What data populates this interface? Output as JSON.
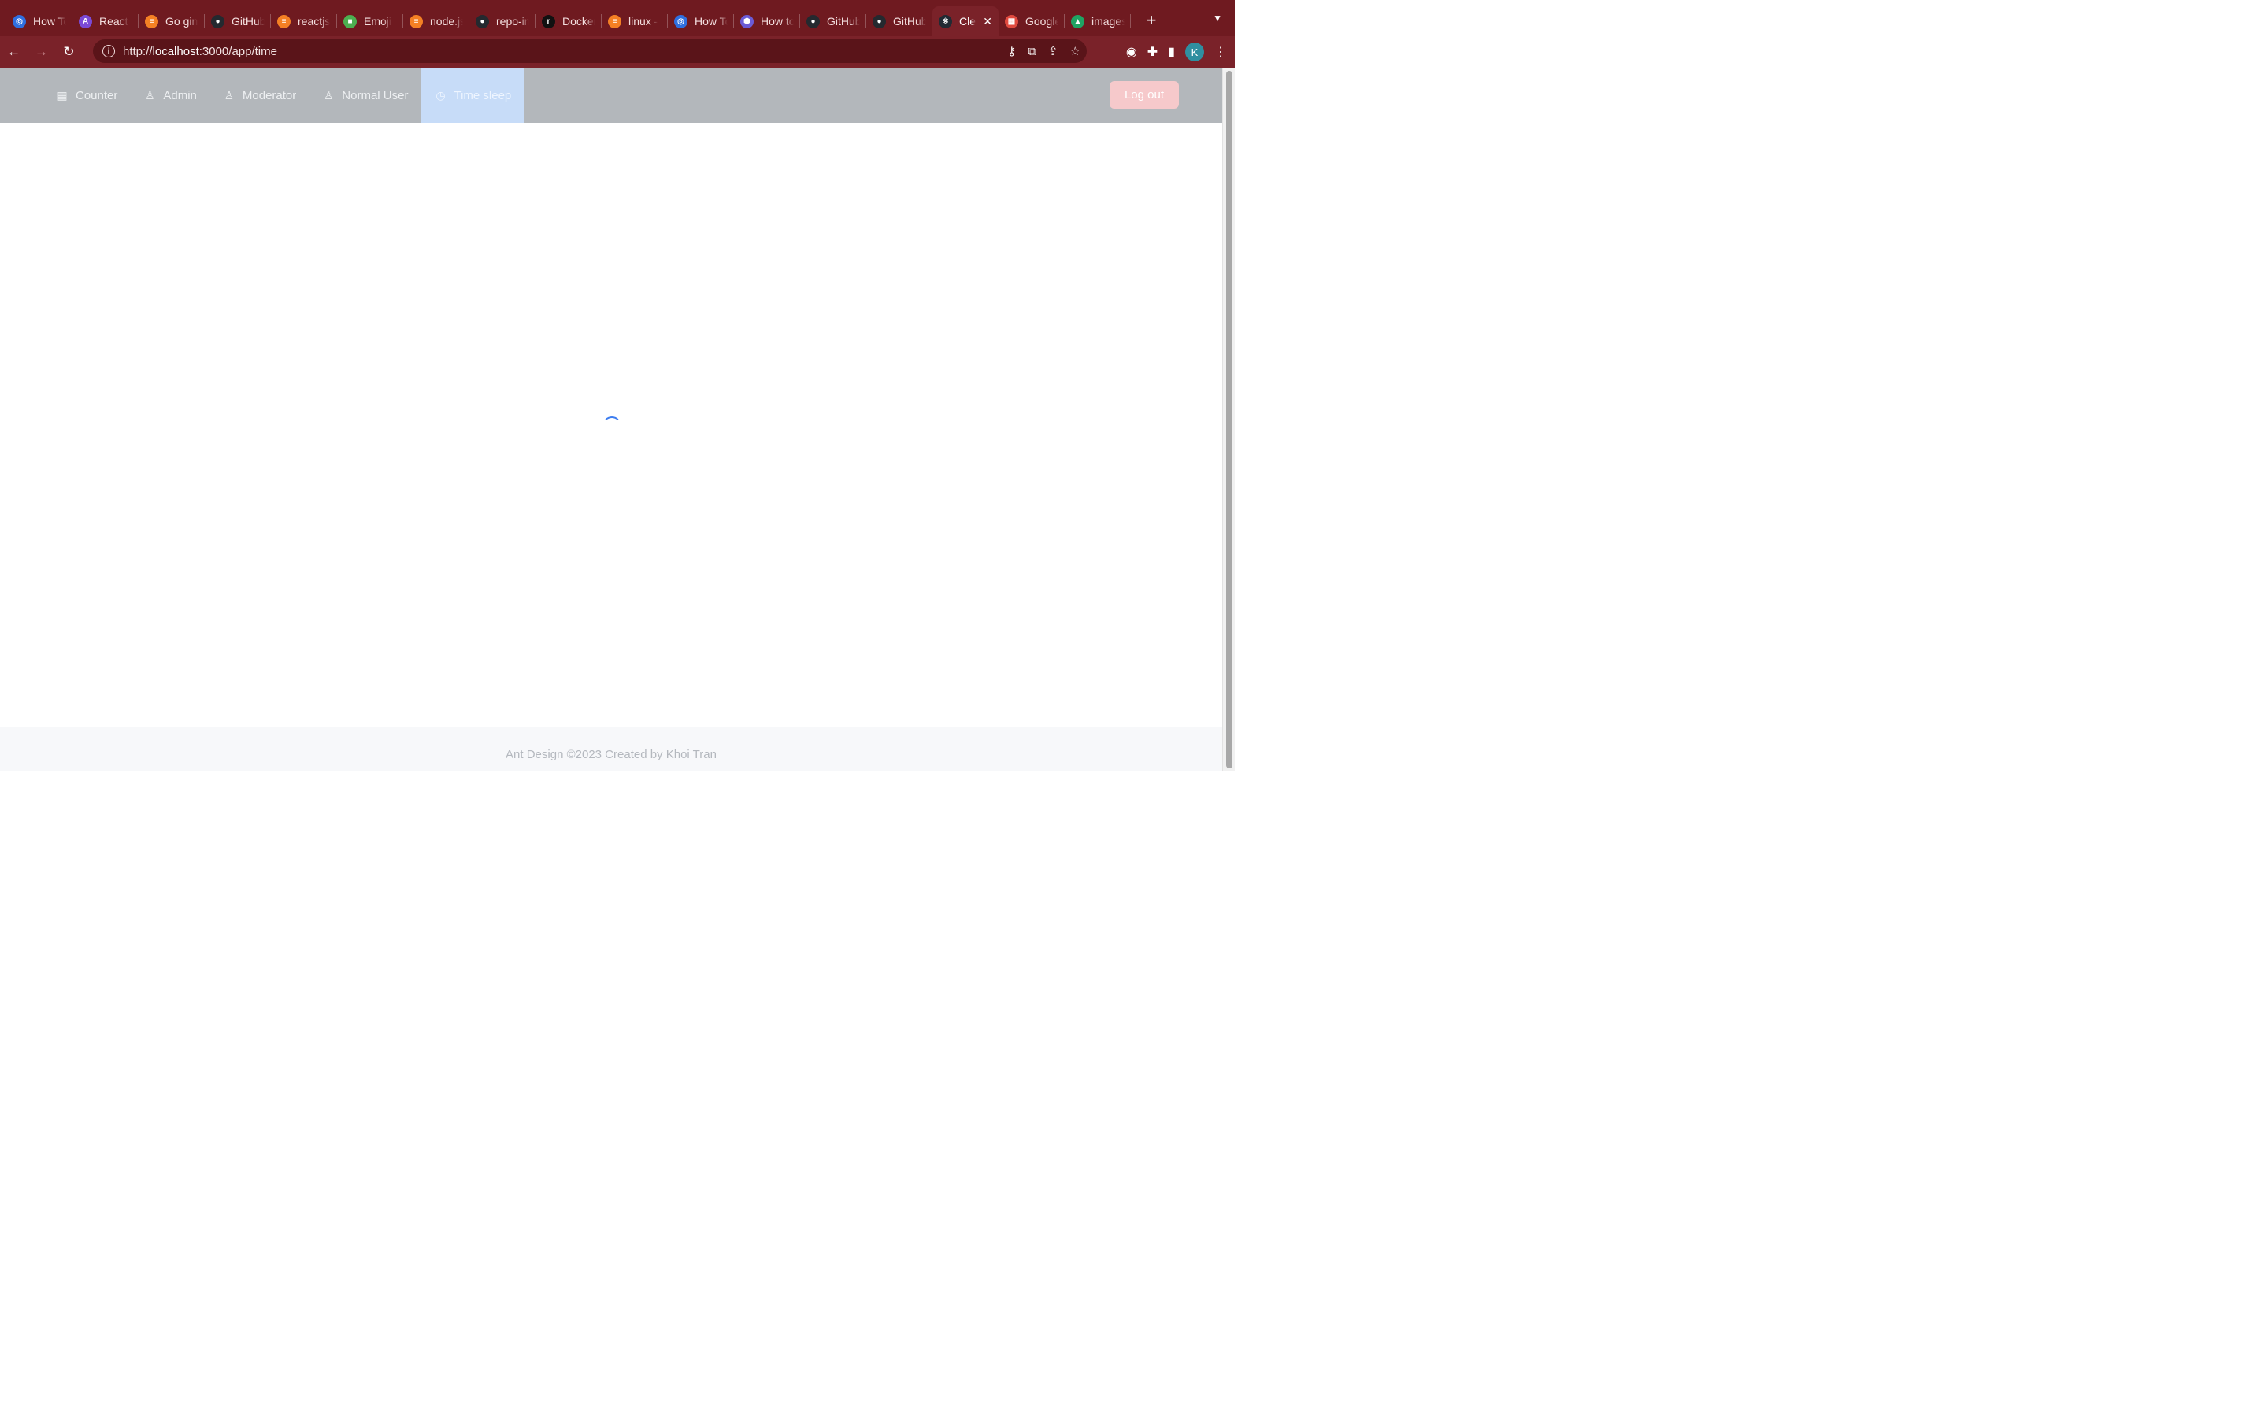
{
  "browser": {
    "tabs": [
      {
        "title": "How To",
        "fav_color": "#2f6fe0",
        "fav_glyph": "◎"
      },
      {
        "title": "React",
        "fav_color": "#7b4ad6",
        "fav_glyph": "A"
      },
      {
        "title": "Go gin",
        "fav_color": "#f48024",
        "fav_glyph": "≡"
      },
      {
        "title": "GitHub",
        "fav_color": "#24292f",
        "fav_glyph": "●"
      },
      {
        "title": "reactjs",
        "fav_color": "#f48024",
        "fav_glyph": "≡"
      },
      {
        "title": "Emoji",
        "fav_color": "#4caf50",
        "fav_glyph": "■"
      },
      {
        "title": "node.js",
        "fav_color": "#f48024",
        "fav_glyph": "≡"
      },
      {
        "title": "repo-in",
        "fav_color": "#24292f",
        "fav_glyph": "●"
      },
      {
        "title": "Docker",
        "fav_color": "#111111",
        "fav_glyph": "r"
      },
      {
        "title": "linux -",
        "fav_color": "#f48024",
        "fav_glyph": "≡"
      },
      {
        "title": "How To",
        "fav_color": "#2f6fe0",
        "fav_glyph": "◎"
      },
      {
        "title": "How to",
        "fav_color": "#6b5bd6",
        "fav_glyph": "⬢"
      },
      {
        "title": "GitHub",
        "fav_color": "#24292f",
        "fav_glyph": "●"
      },
      {
        "title": "GitHub",
        "fav_color": "#24292f",
        "fav_glyph": "●"
      },
      {
        "title": "Cle",
        "fav_color": "#222a33",
        "fav_glyph": "⚛",
        "active": true
      },
      {
        "title": "Google",
        "fav_color": "#e04a3f",
        "fav_glyph": "▦"
      },
      {
        "title": "images",
        "fav_color": "#1fa463",
        "fav_glyph": "▲"
      }
    ],
    "new_tab": "+",
    "url_prefix": "http://",
    "url_host": "localhost",
    "url_rest": ":3000/app/time",
    "avatar_letter": "K"
  },
  "nav": {
    "items": [
      {
        "label": "Counter",
        "icon": "calculator-icon",
        "glyph": "▦"
      },
      {
        "label": "Admin",
        "icon": "user-icon",
        "glyph": "♙"
      },
      {
        "label": "Moderator",
        "icon": "user-icon",
        "glyph": "♙"
      },
      {
        "label": "Normal User",
        "icon": "user-icon",
        "glyph": "♙"
      },
      {
        "label": "Time sleep",
        "icon": "clock-icon",
        "glyph": "◷",
        "selected": true
      }
    ],
    "logout_label": "Log out"
  },
  "footer": {
    "text": "Ant Design ©2023 Created by Khoi Tran"
  },
  "colors": {
    "chrome": "#7a2229",
    "header": "#b3b7bb",
    "selected": "#c7dcf8",
    "logout": "#f6c9cb",
    "spinner": "#3d7df0"
  }
}
